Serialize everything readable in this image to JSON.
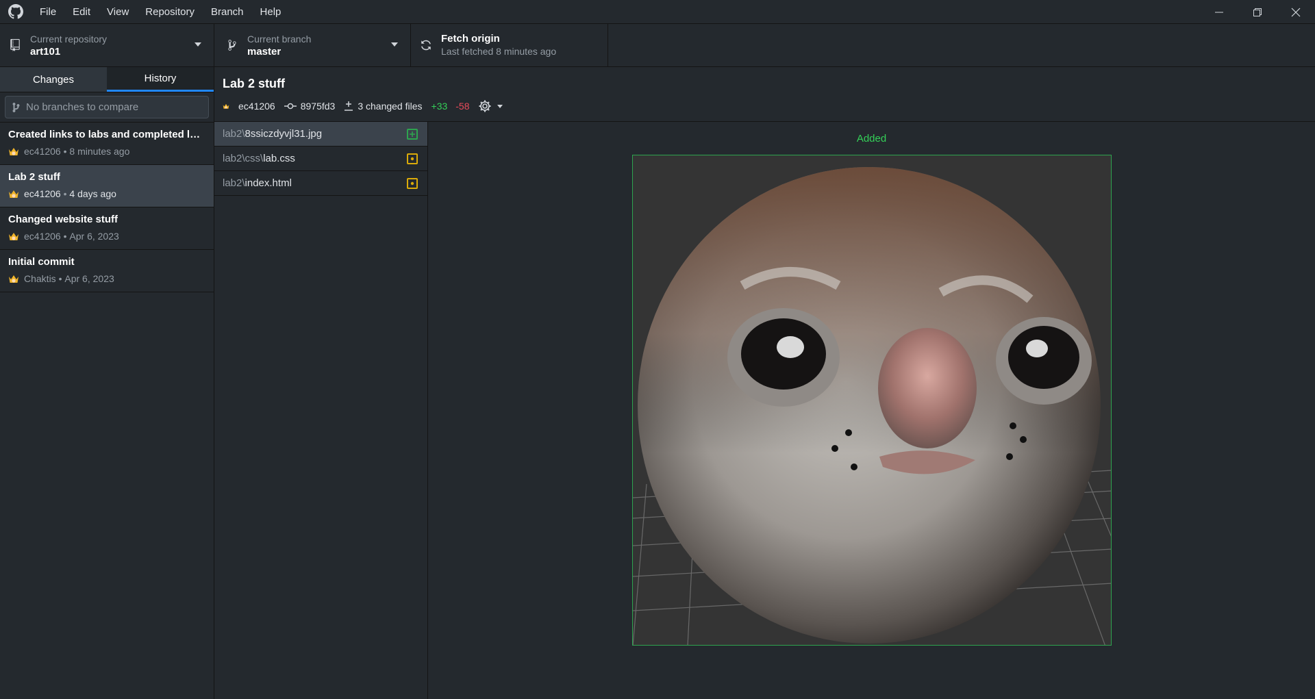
{
  "menu": [
    "File",
    "Edit",
    "View",
    "Repository",
    "Branch",
    "Help"
  ],
  "toolbar": {
    "repo_label": "Current repository",
    "repo_value": "art101",
    "branch_label": "Current branch",
    "branch_value": "master",
    "fetch_title": "Fetch origin",
    "fetch_sub": "Last fetched 8 minutes ago"
  },
  "sidebar": {
    "tabs": [
      "Changes",
      "History"
    ],
    "compare_placeholder": "No branches to compare",
    "commits": [
      {
        "title": "Created links to labs and completed lab 3",
        "author": "ec41206",
        "time": "8 minutes ago"
      },
      {
        "title": "Lab 2 stuff",
        "author": "ec41206",
        "time": "4 days ago"
      },
      {
        "title": "Changed website stuff",
        "author": "ec41206",
        "time": "Apr 6, 2023"
      },
      {
        "title": "Initial commit",
        "author": "Chaktis",
        "time": "Apr 6, 2023"
      }
    ]
  },
  "commit_header": {
    "title": "Lab 2 stuff",
    "author": "ec41206",
    "sha": "8975fd3",
    "changed_files": "3 changed files",
    "additions": "+33",
    "deletions": "-58"
  },
  "files": [
    {
      "dir": "lab2\\",
      "name": "8ssiczdyvjl31.jpg",
      "status": "added"
    },
    {
      "dir": "lab2\\css\\",
      "name": "lab.css",
      "status": "modified"
    },
    {
      "dir": "lab2\\",
      "name": "index.html",
      "status": "modified"
    }
  ],
  "diff": {
    "label": "Added"
  },
  "colors": {
    "accent": "#2188ff",
    "added": "#34d058",
    "deleted": "#ea4a5a",
    "modified": "#dbab09"
  }
}
